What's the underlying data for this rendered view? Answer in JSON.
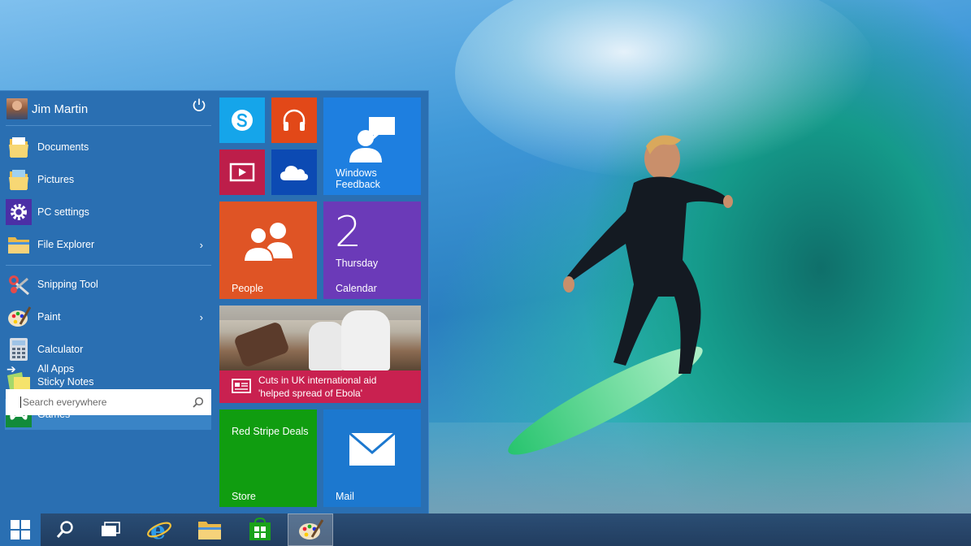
{
  "user": {
    "name": "Jim Martin"
  },
  "places": [
    {
      "label": "Documents",
      "icon": "folder-documents-icon"
    },
    {
      "label": "Pictures",
      "icon": "folder-pictures-icon"
    },
    {
      "label": "PC settings",
      "icon": "gear-icon"
    },
    {
      "label": "File Explorer",
      "icon": "file-explorer-icon",
      "has_submenu": true
    }
  ],
  "apps": [
    {
      "label": "Snipping Tool",
      "icon": "scissors-icon"
    },
    {
      "label": "Paint",
      "icon": "paint-palette-icon",
      "has_submenu": true
    },
    {
      "label": "Calculator",
      "icon": "calculator-icon"
    },
    {
      "label": "Sticky Notes",
      "icon": "sticky-notes-icon"
    },
    {
      "label": "Games",
      "icon": "gamepad-icon",
      "selected": true
    }
  ],
  "all_apps_label": "All Apps",
  "search": {
    "placeholder": "Search everywhere"
  },
  "tiles": {
    "feedback": {
      "label_line1": "Windows",
      "label_line2": "Feedback"
    },
    "people": {
      "label": "People"
    },
    "calendar": {
      "day": "2",
      "weekday": "Thursday",
      "label": "Calendar"
    },
    "news": {
      "headline_line1": "Cuts in UK international aid",
      "headline_line2": "'helped spread of Ebola'"
    },
    "store": {
      "title": "Red Stripe Deals",
      "label": "Store"
    },
    "mail": {
      "label": "Mail"
    }
  },
  "taskbar": {
    "items": [
      "windows-start-icon",
      "search-icon",
      "task-view-icon",
      "internet-explorer-icon",
      "file-explorer-icon",
      "store-icon",
      "paint-palette-icon"
    ],
    "active": "paint-palette-icon"
  },
  "colors": {
    "start_bg": "#2a6fb2",
    "skype": "#15a5ea",
    "music": "#e24818",
    "video": "#bd1e4a",
    "onedrive": "#0c4ab3",
    "feedback": "#1e7fe0",
    "people": "#df5425",
    "calendar": "#6b3ab8",
    "news": "#c92150",
    "store": "#109d10",
    "mail": "#1c78cf"
  }
}
